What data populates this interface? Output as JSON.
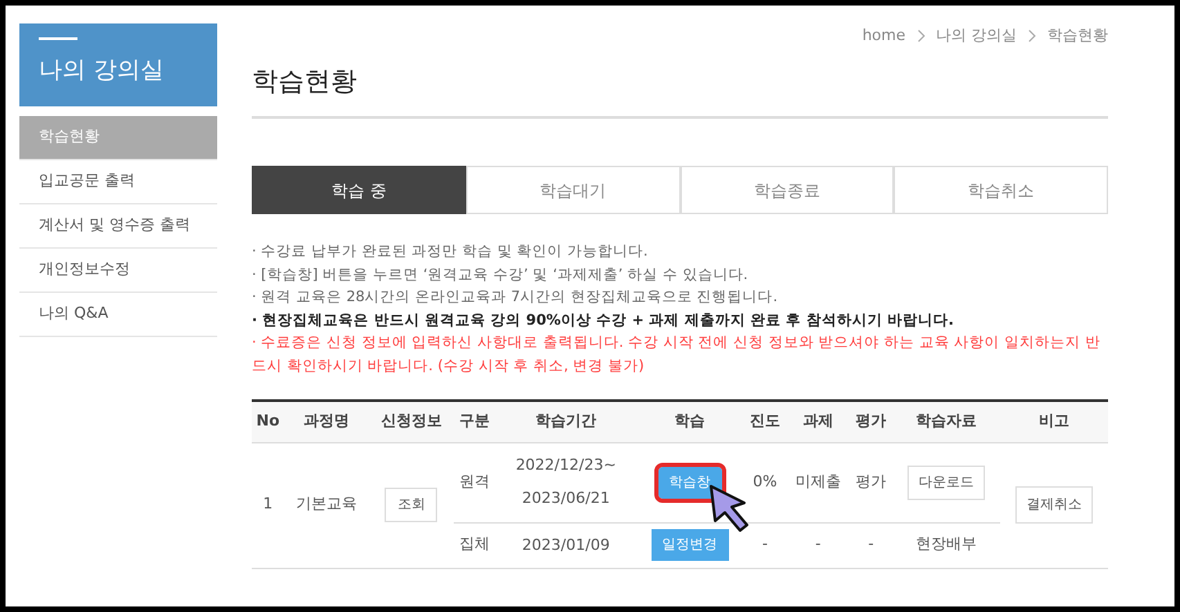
{
  "sidebar": {
    "title": "나의 강의실",
    "items": [
      {
        "label": "학습현황",
        "selected": true
      },
      {
        "label": "입교공문 출력",
        "selected": false
      },
      {
        "label": "계산서 및 영수증 출력",
        "selected": false
      },
      {
        "label": "개인정보수정",
        "selected": false
      },
      {
        "label": "나의 Q&A",
        "selected": false
      }
    ]
  },
  "breadcrumb": [
    "home",
    "나의 강의실",
    "학습현황"
  ],
  "page_title": "학습현황",
  "tabs": [
    {
      "label": "학습 중",
      "selected": true
    },
    {
      "label": "학습대기",
      "selected": false
    },
    {
      "label": "학습종료",
      "selected": false
    },
    {
      "label": "학습취소",
      "selected": false
    }
  ],
  "notes": [
    {
      "kind": "normal",
      "text": "· 수강료 납부가 완료된 과정만 학습 및 확인이 가능합니다."
    },
    {
      "kind": "normal",
      "text": "· [학습창] 버튼을 누르면 ‘원격교육 수강’ 및 ‘과제제출’ 하실 수 있습니다."
    },
    {
      "kind": "normal",
      "text": "· 원격 교육은 28시간의 온라인교육과 7시간의 현장집체교육으로 진행됩니다."
    },
    {
      "kind": "bold",
      "text": "· 현장집체교육은 반드시 원격교육 강의 90%이상 수강 + 과제 제출까지 완료 후 참석하시기 바랍니다."
    },
    {
      "kind": "warning",
      "text": "· 수료증은 신청 정보에 입력하신 사항대로 출력됩니다. 수강 시작 전에 신청 정보와 받으셔야 하는 교육 사항이 일치하는지 반드시 확인하시기 바랍니다. (수강 시작 후 취소, 변경 불가)"
    }
  ],
  "table": {
    "columns": [
      "No",
      "과정명",
      "신청정보",
      "구분",
      "학습기간",
      "학습",
      "진도",
      "과제",
      "평가",
      "학습자료",
      "비고"
    ],
    "rows": [
      {
        "no": "1",
        "course": "기본교육",
        "info_button": "조회",
        "remark_button": "결제취소",
        "sessions": [
          {
            "type": "원격",
            "period": [
              "2022/12/23~",
              "2023/06/21"
            ],
            "study_button": {
              "label": "학습창",
              "highlighted": true
            },
            "progress": "0%",
            "assignment": "미제출",
            "evaluation": "평가",
            "material": {
              "kind": "button",
              "label": "다운로드"
            }
          },
          {
            "type": "집체",
            "period": [
              "2023/01/09"
            ],
            "study_button": {
              "label": "일정변경",
              "highlighted": false
            },
            "progress": "-",
            "assignment": "-",
            "evaluation": "-",
            "material": {
              "kind": "text",
              "label": "현장배부"
            }
          }
        ]
      }
    ]
  }
}
